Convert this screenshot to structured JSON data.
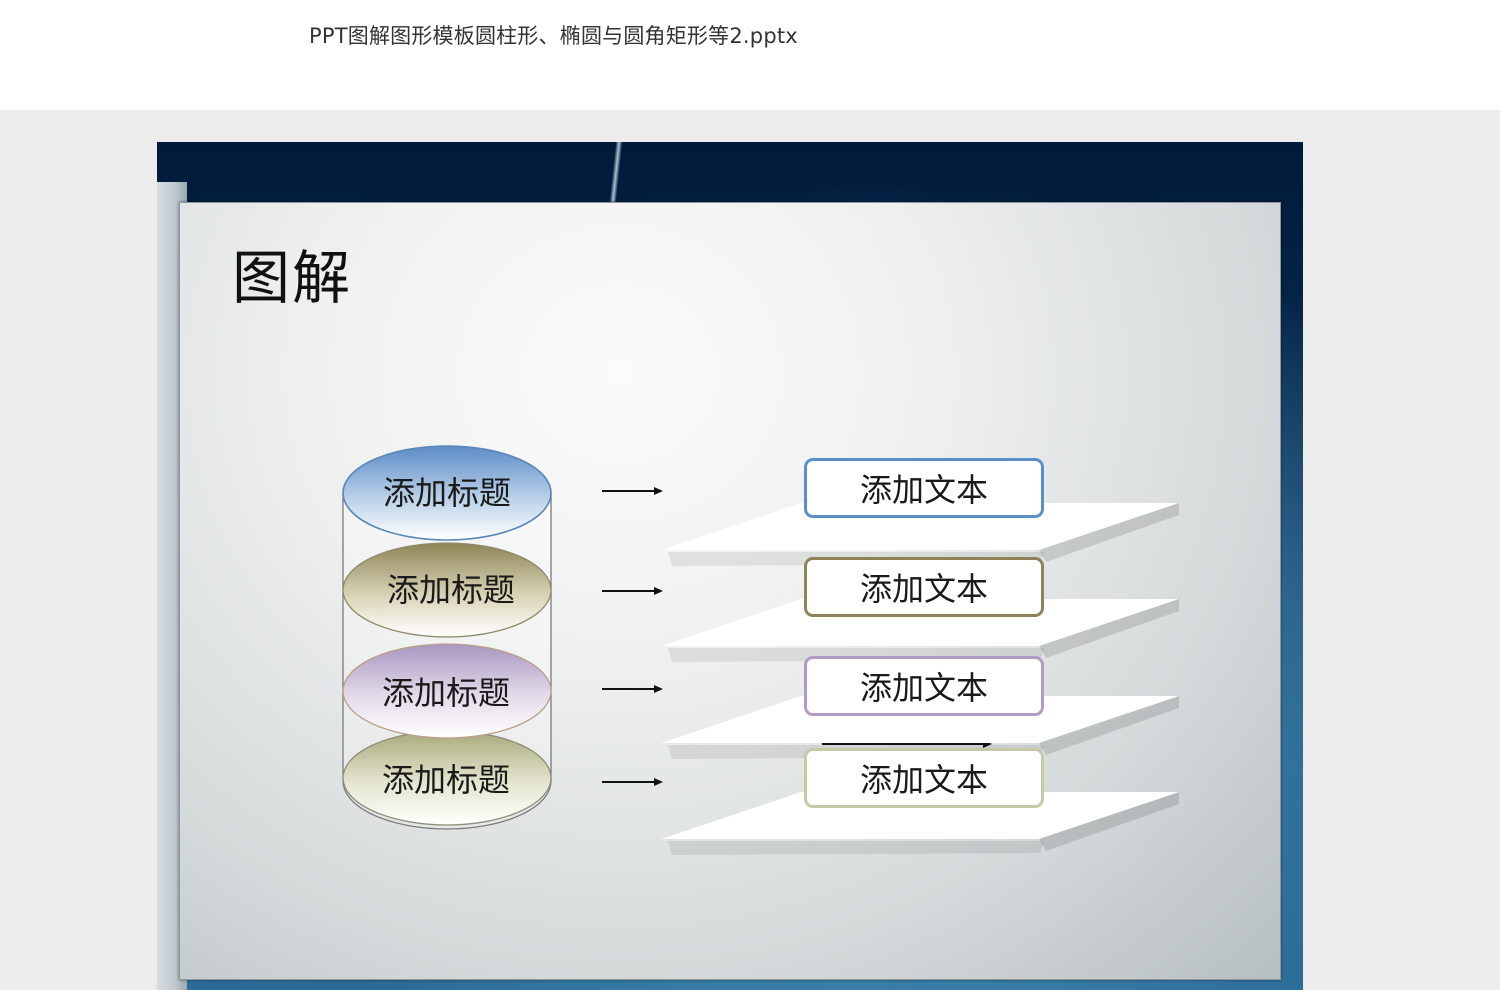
{
  "document": {
    "title": "PPT图解图形模板圆柱形、椭圆与圆角矩形等2.pptx"
  },
  "slide": {
    "title": "图解",
    "cylinder": {
      "labels": [
        "添加标题",
        "添加标题",
        "添加标题",
        "添加标题"
      ],
      "colors": [
        "#6a96c6",
        "#9f9464",
        "#b2a1c2",
        "#b7b98c"
      ]
    },
    "boxes": {
      "labels": [
        "添加文本",
        "添加文本",
        "添加文本",
        "添加文本"
      ],
      "border_colors": [
        "#5b8fc9",
        "#8e8259",
        "#b09bc5",
        "#c5c9a5"
      ]
    }
  }
}
